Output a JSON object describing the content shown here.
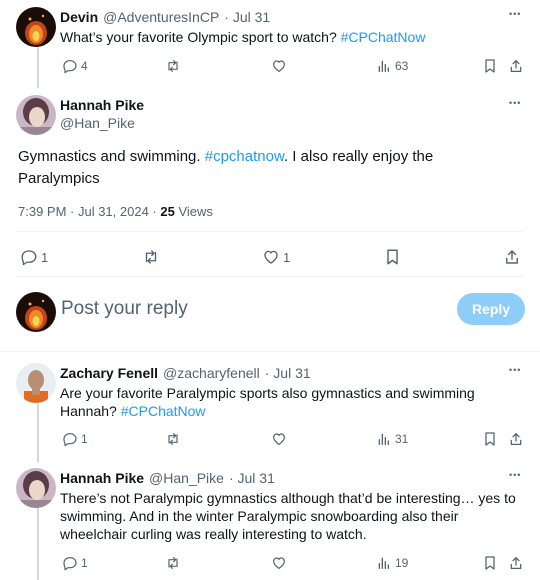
{
  "tweets": [
    {
      "name": "Devin",
      "handle": "@AdventuresInCP",
      "date": "· Jul 31",
      "text": "What’s your favorite Olympic sport to watch?",
      "hashtag": "#CPChatNow",
      "replies": "4",
      "views": "63"
    },
    {
      "name": "Zachary Fenell",
      "handle": "@zacharyfenell",
      "date": "· Jul 31",
      "text_line1": "Are your favorite Paralympic sports also gymnastics and swimming",
      "text_line2": "Hannah?",
      "hashtag": "#CPChatNow",
      "replies": "1",
      "views": "31"
    },
    {
      "name": "Hannah Pike",
      "handle": "@Han_Pike",
      "date": "· Jul 31",
      "text_line1": "There’s not Paralympic gymnastics although that’d be interesting… yes to",
      "text_line2": "swimming. And in the winter Paralympic snowboarding also their",
      "text_line3": "wheelchair curling was really interesting to watch.",
      "replies": "1",
      "views": "19"
    }
  ],
  "main": {
    "name": "Hannah Pike",
    "handle": "@Han_Pike",
    "text_a": "Gymnastics and swimming.",
    "hashtag": "#cpchatnow",
    "text_b": ". I also really enjoy the",
    "text_line2": "Paralympics",
    "timestamp": "7:39 PM · Jul 31, 2024 ·",
    "views_count": "25",
    "views_label": "Views",
    "replies": "1",
    "likes": "1"
  },
  "compose": {
    "placeholder": "Post your reply",
    "reply_label": "Reply"
  },
  "more_glyph": "•••",
  "colors": {
    "accent": "#1d9bf0",
    "reply_disabled": "#8ecdf8",
    "muted": "#536471"
  }
}
